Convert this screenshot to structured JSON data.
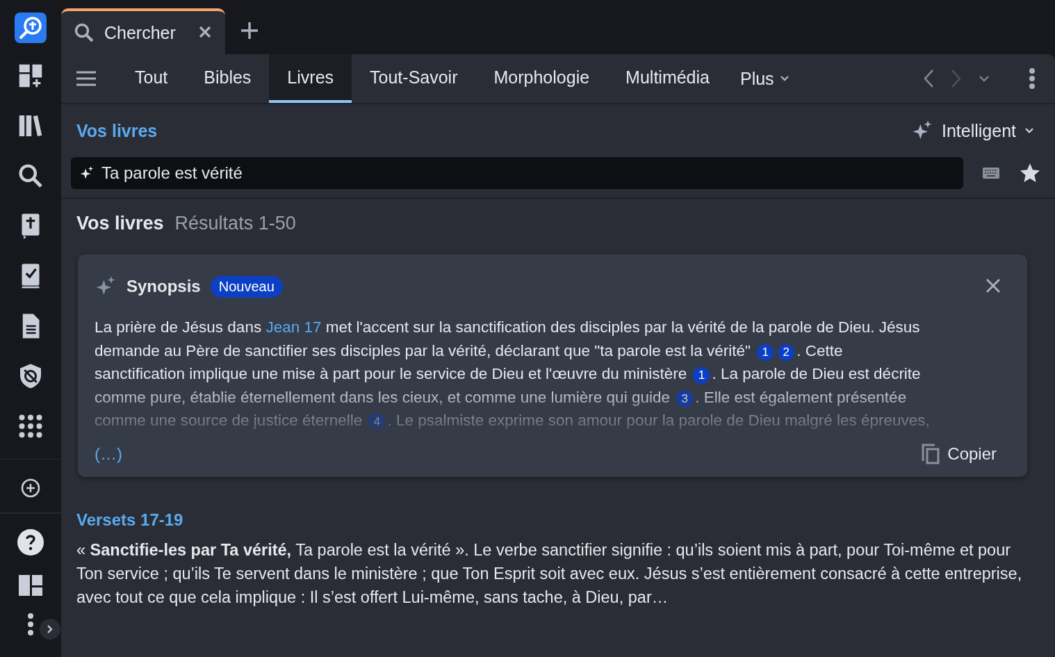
{
  "tab": {
    "label": "Chercher",
    "selected": true
  },
  "nav_tabs": [
    {
      "label": "Tout",
      "selected": false
    },
    {
      "label": "Bibles",
      "selected": false
    },
    {
      "label": "Livres",
      "selected": true
    },
    {
      "label": "Tout-Savoir",
      "selected": false
    },
    {
      "label": "Morphologie",
      "selected": false
    },
    {
      "label": "Multimédia",
      "selected": false
    }
  ],
  "more_menu": {
    "label": "Plus"
  },
  "scope_link": "Vos livres",
  "search_mode": "Intelligent",
  "search_field": {
    "value": "Ta parole est vérité"
  },
  "results_header": {
    "title": "Vos livres",
    "count": "Résultats 1-50"
  },
  "synopsis": {
    "title": "Synopsis",
    "badge": "Nouveau",
    "lines": [
      [
        {
          "kind": "text",
          "text": "La prière de Jésus dans "
        },
        {
          "kind": "link",
          "text": "Jean 17"
        },
        {
          "kind": "text",
          "text": " met l'accent sur la sanctification des disciples par la vérité de la parole de Dieu. Jésus"
        }
      ],
      [
        {
          "kind": "text",
          "text": "demande au Père de sanctifier ses disciples par la vérité, déclarant que \"ta parole est la vérité\" "
        },
        {
          "kind": "cite",
          "text": "1"
        },
        {
          "kind": "cite",
          "text": "2"
        },
        {
          "kind": "text",
          "text": ". Cette"
        }
      ],
      [
        {
          "kind": "text",
          "text": "sanctification implique une mise à part pour le service de Dieu et l'œuvre du ministère "
        },
        {
          "kind": "cite",
          "text": "1"
        },
        {
          "kind": "text",
          "text": ". La parole de Dieu est décrite"
        }
      ],
      [
        {
          "kind": "text",
          "text": "comme pure, établie éternellement dans les cieux, et comme une lumière qui guide "
        },
        {
          "kind": "cite",
          "text": "3"
        },
        {
          "kind": "text",
          "text": ". Elle est également présentée"
        }
      ],
      [
        {
          "kind": "text",
          "text": "comme une source de justice éternelle "
        },
        {
          "kind": "cite",
          "text": "4"
        },
        {
          "kind": "text",
          "text": ". Le psalmiste exprime son amour pour la parole de Dieu malgré les épreuves,"
        }
      ]
    ],
    "more_link": "(…)",
    "copy_button": "Copier"
  },
  "result": {
    "heading": "Versets 17-19",
    "excerpt": "« **Sanctifie-les par Ta vérité,** Ta parole est la vérité ». Le verbe sanctifier signifie : qu’ils soient mis à part, pour Toi-même et pour Ton service ; qu’ils Te servent dans le ministère ; que Ton Esprit soit avec eux. Jésus s’est entièrement consacré à cette entreprise, avec tout ce que cela implique : Il s’est offert Lui-même, sans tache, à Dieu, par…"
  }
}
